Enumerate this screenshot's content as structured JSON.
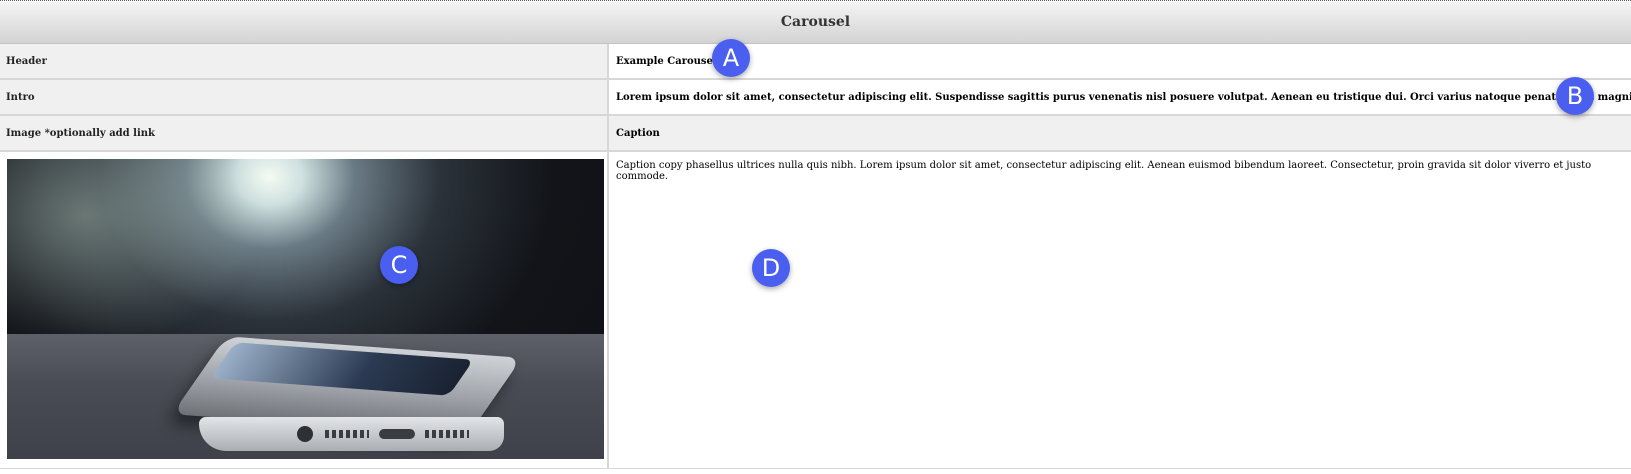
{
  "title": "Carousel",
  "rows": {
    "header": {
      "label": "Header",
      "value": "Example Carousel"
    },
    "intro": {
      "label": "Intro",
      "value": "Lorem ipsum dolor sit amet, consectetur adipiscing elit. Suspendisse sagittis purus venenatis nisl posuere volutpat. Aenean eu tristique dui. Orci varius natoque penatibus et magnis dis parturient montes, nascetur ridiculus mus."
    },
    "image_header": {
      "label": "Image *optionally add link",
      "caption_label": "Caption"
    },
    "content": {
      "image_name": "phone-photo",
      "caption": "Caption copy phasellus ultrices nulla quis nibh. Lorem ipsum dolor sit amet, consectetur adipiscing elit. Aenean euismod bibendum laoreet. Consectetur, proin gravida sit dolor viverro et justo commode."
    }
  },
  "markers": {
    "a": "A",
    "b": "B",
    "c": "C",
    "d": "D"
  },
  "colors": {
    "marker": "#4a5ef0",
    "label_bg": "#f0f0f0",
    "border": "#d7d7d7"
  }
}
